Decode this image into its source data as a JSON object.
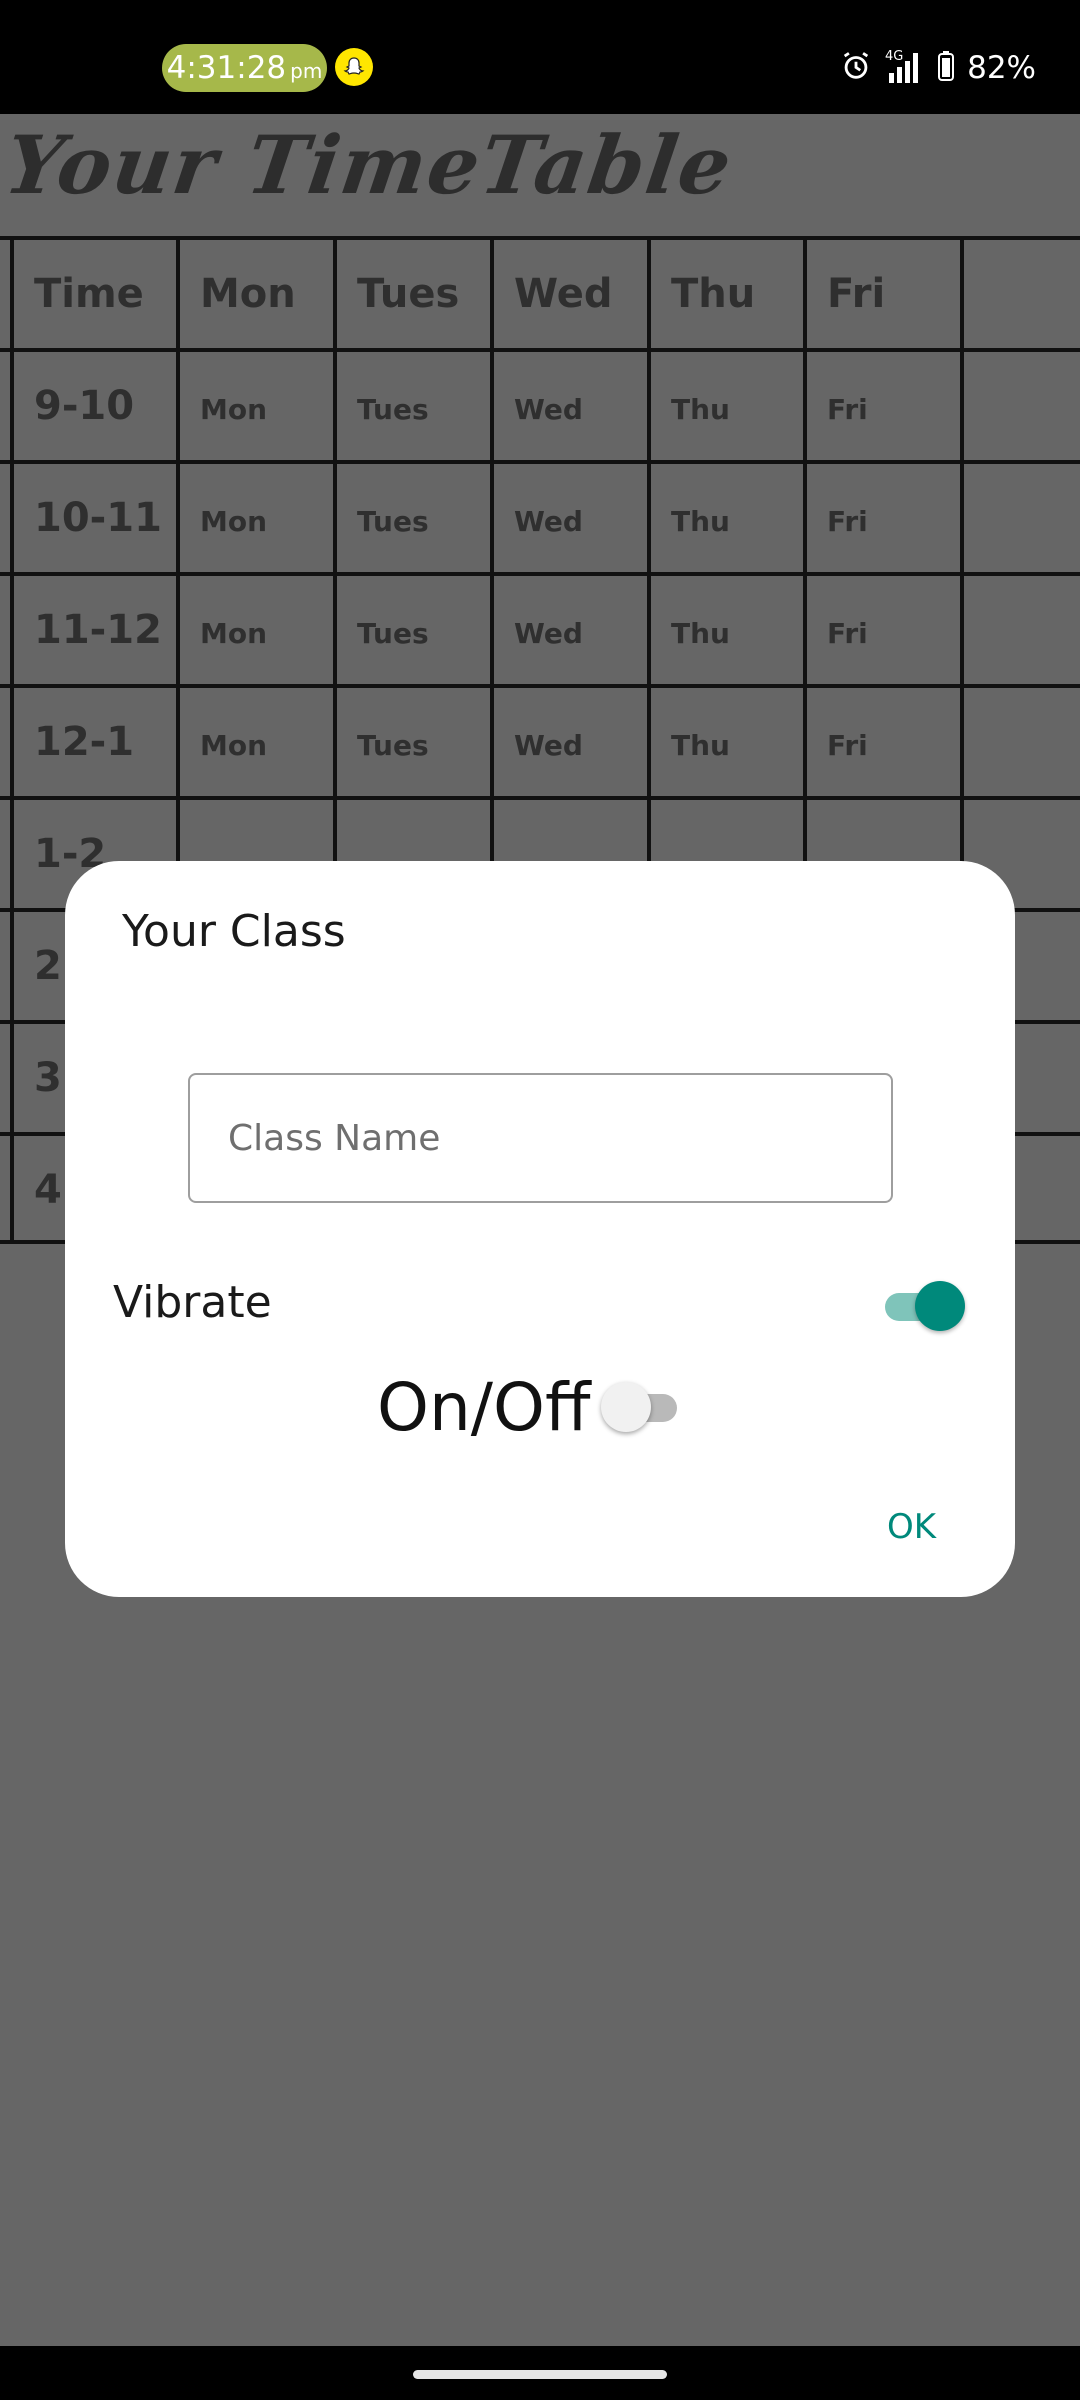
{
  "status_bar": {
    "time": "4:31:28",
    "ampm": "pm",
    "battery_percent": "82%",
    "icons": [
      "snapchat-icon",
      "alarm-icon",
      "4g-signal-icon",
      "battery-icon"
    ]
  },
  "app": {
    "title": "Your TimeTable",
    "header": [
      "Time",
      "Mon",
      "Tues",
      "Wed",
      "Thu",
      "Fri"
    ],
    "rows": [
      {
        "time": "9-10",
        "cells": [
          "Mon",
          "Tues",
          "Wed",
          "Thu",
          "Fri"
        ]
      },
      {
        "time": "10-11",
        "cells": [
          "Mon",
          "Tues",
          "Wed",
          "Thu",
          "Fri"
        ]
      },
      {
        "time": "11-12",
        "cells": [
          "Mon",
          "Tues",
          "Wed",
          "Thu",
          "Fri"
        ]
      },
      {
        "time": "12-1",
        "cells": [
          "Mon",
          "Tues",
          "Wed",
          "Thu",
          "Fri"
        ]
      },
      {
        "time": "1-2",
        "cells": [
          "",
          "",
          "",
          "",
          ""
        ]
      },
      {
        "time": "2",
        "cells": [
          "",
          "",
          "",
          "",
          ""
        ]
      },
      {
        "time": "3",
        "cells": [
          "",
          "",
          "",
          "",
          ""
        ]
      },
      {
        "time": "4",
        "cells": [
          "",
          "",
          "",
          "",
          ""
        ]
      }
    ]
  },
  "dialog": {
    "title": "Your Class",
    "class_name_placeholder": "Class Name",
    "class_name_value": "",
    "vibrate_label": "Vibrate",
    "vibrate_on": true,
    "onoff_label": "On/Off",
    "onoff_on": false,
    "ok_label": "OK"
  },
  "colors": {
    "accent": "#00897b",
    "scrim_background": "#666666",
    "clock_pill": "#a6b84a"
  }
}
